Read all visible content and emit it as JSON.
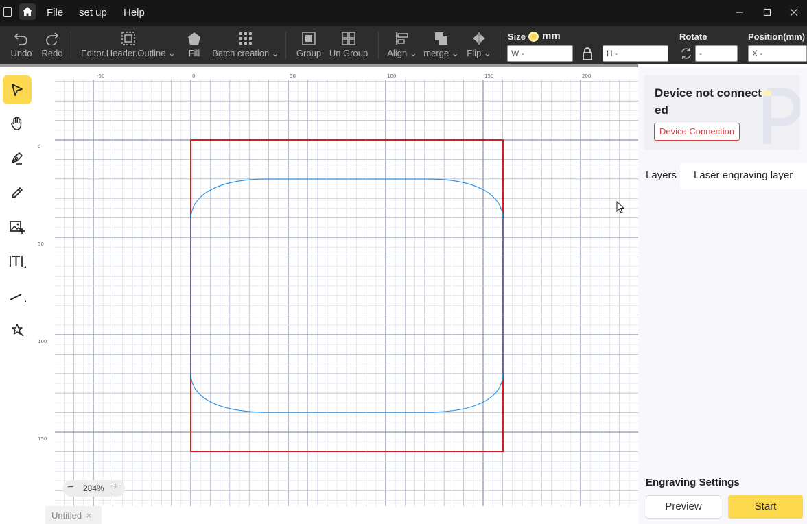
{
  "menu": {
    "file": "File",
    "setup": "set up",
    "help": "Help"
  },
  "toolbar": {
    "undo": "Undo",
    "redo": "Redo",
    "outline": "Editor.Header.Outline",
    "fill": "Fill",
    "batch": "Batch creation",
    "group": "Group",
    "ungroup": "Un Group",
    "align": "Align",
    "merge": "merge",
    "flip": "Flip",
    "size_label": "Size",
    "unit": "mm",
    "width_field": "W -",
    "height_field": "H -",
    "rotate_label": "Rotate",
    "rotate_field": "-",
    "position_label": "Position(mm)",
    "x_field": "X -"
  },
  "rulers": {
    "top": [
      "-50",
      "0",
      "50",
      "100",
      "150",
      "200"
    ],
    "left": [
      "0",
      "50",
      "100",
      "150"
    ]
  },
  "zoom": {
    "level": "284%",
    "minus": "−",
    "plus": "+"
  },
  "tabs": {
    "current": "Untitled",
    "close": "×"
  },
  "device": {
    "title": "Device not connected",
    "connect_button": "Device Connection"
  },
  "right_tabs": {
    "layers": "Layers",
    "laser_layer": "Laser engraving layer"
  },
  "engraving": {
    "title": "Engraving Settings",
    "preview": "Preview",
    "start": "Start"
  },
  "colors": {
    "accent": "#fcd94e",
    "selection": "#e0191f",
    "shape_stroke": "#2e93e8",
    "device_button": "#e23a3a"
  }
}
